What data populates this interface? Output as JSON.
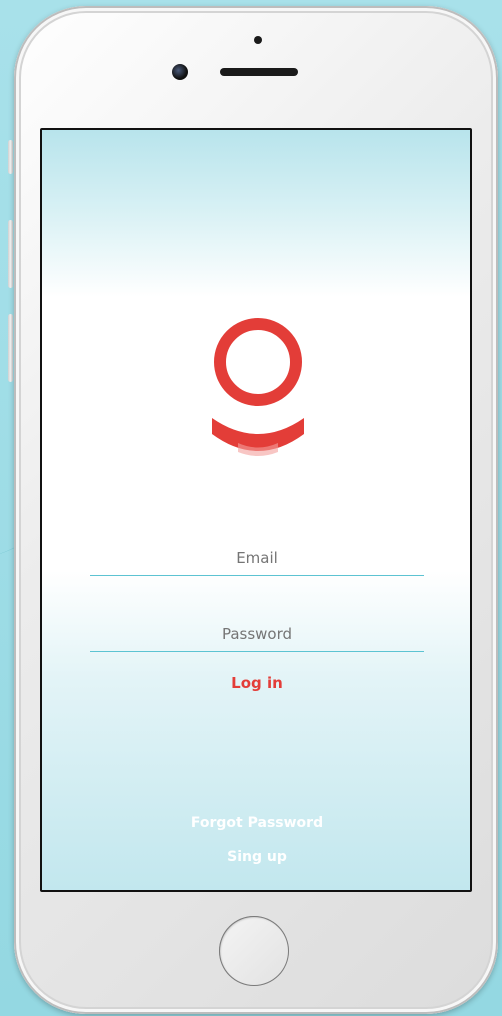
{
  "login_form": {
    "email_placeholder": "Email",
    "password_placeholder": "Password",
    "login_label": "Log in"
  },
  "footer": {
    "forgot_password_label": "Forgot Password",
    "signup_label": "Sing up"
  },
  "colors": {
    "brand_red": "#e33d38",
    "accent_teal": "#3fb9cc",
    "background": "#9fdde6"
  },
  "icons": {
    "logo": "app-logo-icon"
  }
}
